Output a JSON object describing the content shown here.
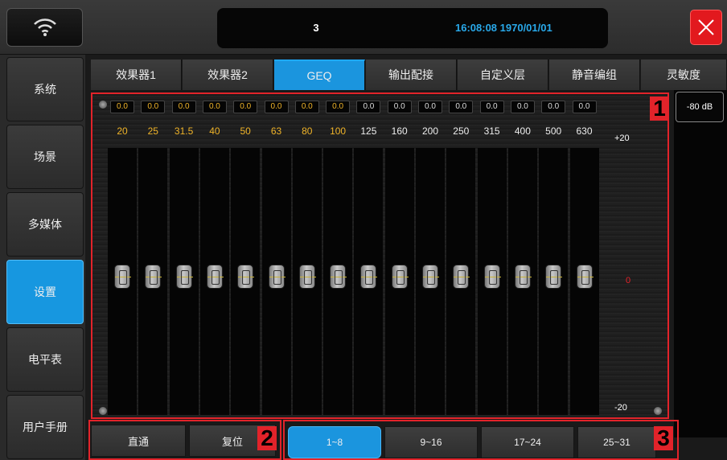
{
  "header": {
    "wifi_icon": "wifi-icon",
    "scene_number": "3",
    "clock": "16:08:08 1970/01/01",
    "close_icon": "close-icon",
    "accent_color": "#1b95de",
    "close_color": "#e2191e"
  },
  "sidebar": {
    "items": [
      {
        "label": "系统",
        "active": false
      },
      {
        "label": "场景",
        "active": false
      },
      {
        "label": "多媒体",
        "active": false
      },
      {
        "label": "设置",
        "active": true
      },
      {
        "label": "电平表",
        "active": false
      },
      {
        "label": "用户手册",
        "active": false
      }
    ]
  },
  "tabs": [
    {
      "label": "效果器1",
      "active": false
    },
    {
      "label": "效果器2",
      "active": false
    },
    {
      "label": "GEQ",
      "active": true
    },
    {
      "label": "输出配接",
      "active": false
    },
    {
      "label": "自定义层",
      "active": false
    },
    {
      "label": "静音编组",
      "active": false
    },
    {
      "label": "灵敏度",
      "active": false
    }
  ],
  "sensitivity": {
    "value": "-80 dB"
  },
  "geq": {
    "bands": [
      {
        "gain": "0.0",
        "freq": "20",
        "highlight": true
      },
      {
        "gain": "0.0",
        "freq": "25",
        "highlight": true
      },
      {
        "gain": "0.0",
        "freq": "31.5",
        "highlight": true
      },
      {
        "gain": "0.0",
        "freq": "40",
        "highlight": true
      },
      {
        "gain": "0.0",
        "freq": "50",
        "highlight": true
      },
      {
        "gain": "0.0",
        "freq": "63",
        "highlight": true
      },
      {
        "gain": "0.0",
        "freq": "80",
        "highlight": true
      },
      {
        "gain": "0.0",
        "freq": "100",
        "highlight": true
      },
      {
        "gain": "0.0",
        "freq": "125",
        "highlight": false
      },
      {
        "gain": "0.0",
        "freq": "160",
        "highlight": false
      },
      {
        "gain": "0.0",
        "freq": "200",
        "highlight": false
      },
      {
        "gain": "0.0",
        "freq": "250",
        "highlight": false
      },
      {
        "gain": "0.0",
        "freq": "315",
        "highlight": false
      },
      {
        "gain": "0.0",
        "freq": "400",
        "highlight": false
      },
      {
        "gain": "0.0",
        "freq": "500",
        "highlight": false
      },
      {
        "gain": "0.0",
        "freq": "630",
        "highlight": false
      }
    ],
    "scale_top": "+20",
    "scale_mid": "0",
    "scale_bottom": "-20"
  },
  "bottom": {
    "bypass_label": "直通",
    "reset_label": "复位",
    "pages": [
      {
        "label": "1~8",
        "active": true
      },
      {
        "label": "9~16",
        "active": false
      },
      {
        "label": "17~24",
        "active": false
      },
      {
        "label": "25~31",
        "active": false
      }
    ]
  },
  "callouts": [
    "1",
    "2",
    "3"
  ]
}
